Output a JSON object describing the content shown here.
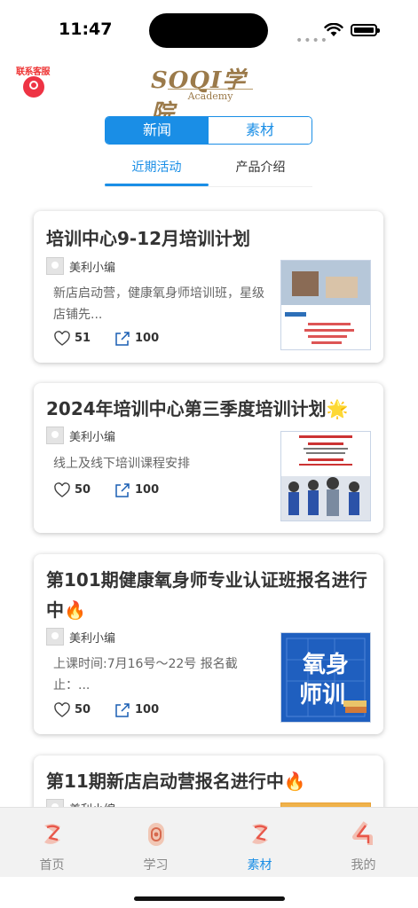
{
  "status": {
    "time": "11:47"
  },
  "header": {
    "service_label": "联系客服",
    "logo_main": "SOQI学院",
    "logo_sub": "Academy"
  },
  "segmented": {
    "tabs": [
      "新闻",
      "素材"
    ],
    "active": 0
  },
  "subtabs": {
    "tabs": [
      "近期活动",
      "产品介绍"
    ],
    "active": 0
  },
  "cards": [
    {
      "title": "培训中心9-12月培训计划",
      "author": "美利小编",
      "summary": "新店启动营，健康氧身师培训班，星级店铺先...",
      "likes": "51",
      "shares": "100"
    },
    {
      "title": "2024年培训中心第三季度培训计划🌟",
      "author": "美利小编",
      "summary": "线上及线下培训课程安排",
      "likes": "50",
      "shares": "100"
    },
    {
      "title": "第101期健康氧身师专业认证班报名进行中🔥",
      "author": "美利小编",
      "summary": "上课时间:7月16号～22号 报名截止：...",
      "likes": "50",
      "shares": "100",
      "thumb_text": "氧身师训"
    },
    {
      "title": "第11期新店启动营报名进行中🔥",
      "author": "美利小编"
    }
  ],
  "nav": {
    "items": [
      "首页",
      "学习",
      "素材",
      "我的"
    ],
    "active": 2
  },
  "colors": {
    "accent": "#1a8ee6",
    "logo": "#9b7a4a"
  }
}
